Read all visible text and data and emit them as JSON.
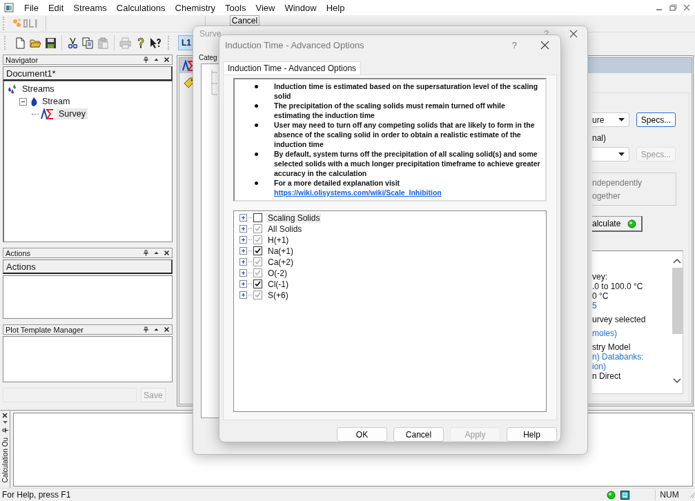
{
  "menu": [
    "File",
    "Edit",
    "Streams",
    "Calculations",
    "Chemistry",
    "Tools",
    "View",
    "Window",
    "Help"
  ],
  "toolbar": {
    "level_button": "L1",
    "cancel_button": "Cancel"
  },
  "navigator": {
    "title": "Navigator",
    "header": "Document1*",
    "tree": [
      {
        "label": "Streams",
        "kind": "streams",
        "selected": false,
        "children": [
          {
            "label": "Stream",
            "kind": "stream",
            "selected": false,
            "expanded": true,
            "children": [
              {
                "label": "Survey",
                "kind": "survey",
                "selected": true
              }
            ]
          }
        ]
      }
    ]
  },
  "actions": {
    "title": "Actions",
    "header": "Actions"
  },
  "plot_templates": {
    "title": "Plot Template Manager",
    "save_button": {
      "label": "Save",
      "disabled": true
    }
  },
  "output_pane": {
    "title": "Calculation Ou"
  },
  "status_bar": {
    "text": "For Help, press F1",
    "indicator": "NUM"
  },
  "survey_window": {
    "type_dropdown": "ure",
    "specs_button": {
      "label": "Specs...",
      "disabled": false
    },
    "optional_label": "nal)",
    "second_specs_button": {
      "label": "Specs...",
      "disabled": true
    },
    "options": [
      "ndependently",
      "ogether"
    ],
    "calculate_button": "alculate",
    "summary": [
      {
        "text": "vey:",
        "kind": "plain",
        "spaced": false
      },
      {
        "text": ".0 to 100.0 °C",
        "kind": "plain",
        "spaced": false
      },
      {
        "text": "0 °C",
        "kind": "plain",
        "spaced": false
      },
      {
        "text": "5",
        "kind": "link",
        "spaced": false
      },
      {
        "text": "urvey selected",
        "kind": "plain",
        "spaced": true
      },
      {
        "text": "moles)",
        "kind": "link",
        "spaced": true
      },
      {
        "text": "stry Model",
        "kind": "plain",
        "spaced": true
      },
      {
        "text": "n) Databanks:",
        "kind": "link",
        "spaced": false
      },
      {
        "text": "ion)",
        "kind": "link",
        "spaced": false
      },
      {
        "text": "n Direct",
        "kind": "plain",
        "spaced": false
      }
    ]
  },
  "survey_options": {
    "title": "Surve",
    "help": "?",
    "category_label": "Categ"
  },
  "induction_dialog": {
    "title": "Induction Time - Advanced Options",
    "help": "?",
    "tab": {
      "label": "Induction Time - Advanced Options",
      "selected": true
    },
    "notes": [
      "Induction time is estimated based on the supersaturation level of the scaling solid",
      "The precipitation of the scaling solids must remain turned off while estimating the induction time",
      "User may need to turn off any competing solids that are likely to form in the absence of the scaling solid in order to obtain a realistic estimate of the induction time",
      "By default, system turns off the precipitation of all scaling solid(s) and some selected solids with a much longer precipitation timeframe to achieve greater accuracy in the calculation",
      "For a more detailed explanation visit"
    ],
    "link": "https://wiki.olisystems.com/wiki/Scale_Inhibition",
    "tree": [
      {
        "label": "Scaling Solids",
        "checked": false,
        "disabled": false,
        "expanded": false,
        "selected": true
      },
      {
        "label": "All Solids",
        "checked": true,
        "disabled": true,
        "expanded": false,
        "selected": false
      },
      {
        "label": "H(+1)",
        "checked": true,
        "disabled": true,
        "expanded": false,
        "selected": false
      },
      {
        "label": "Na(+1)",
        "checked": true,
        "disabled": false,
        "expanded": false,
        "selected": false
      },
      {
        "label": "Ca(+2)",
        "checked": true,
        "disabled": true,
        "expanded": false,
        "selected": false
      },
      {
        "label": "O(-2)",
        "checked": true,
        "disabled": true,
        "expanded": false,
        "selected": false
      },
      {
        "label": "Cl(-1)",
        "checked": true,
        "disabled": false,
        "expanded": false,
        "selected": false
      },
      {
        "label": "S(+6)",
        "checked": true,
        "disabled": true,
        "expanded": false,
        "selected": false
      }
    ],
    "buttons": [
      {
        "label": "OK",
        "disabled": false
      },
      {
        "label": "Cancel",
        "disabled": false
      },
      {
        "label": "Apply",
        "disabled": true
      },
      {
        "label": "Help",
        "disabled": false
      }
    ]
  }
}
